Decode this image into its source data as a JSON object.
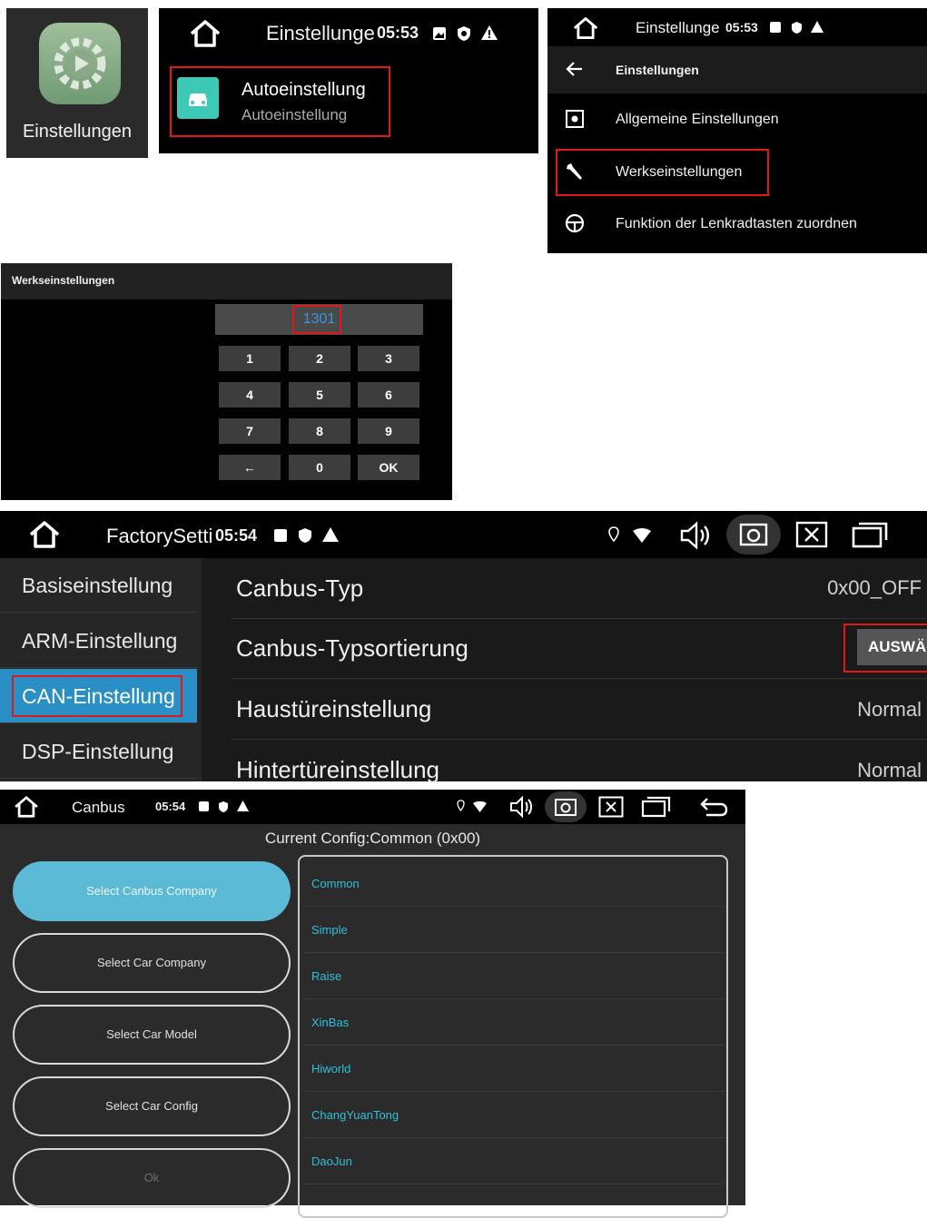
{
  "panel1": {
    "app_label": "Einstellungen"
  },
  "panel2": {
    "title": "Einstellunge",
    "time": "05:53",
    "item_title": "Autoeinstellung",
    "item_subtitle": "Autoeinstellung"
  },
  "panel3": {
    "title": "Einstellunge",
    "time": "05:53",
    "back_label": "Einstellungen",
    "items": [
      {
        "label": "Allgemeine Einstellungen",
        "icon": "settings-icon"
      },
      {
        "label": "Werkseinstellungen",
        "icon": "wrench-icon"
      },
      {
        "label": "Funktion der Lenkradtasten zuordnen",
        "icon": "steering-wheel-icon"
      }
    ]
  },
  "panel4": {
    "header": "Werkseinstellungen",
    "password_value": "1301",
    "keys": [
      "1",
      "2",
      "3",
      "4",
      "5",
      "6",
      "7",
      "8",
      "9",
      "←",
      "0",
      "OK"
    ]
  },
  "panel5": {
    "title": "FactorySetti",
    "time": "05:54",
    "sidebar": [
      "Basiseinstellung",
      "ARM-Einstellung",
      "CAN-Einstellung",
      "DSP-Einstellung"
    ],
    "active_sidebar": "CAN-Einstellung",
    "rows": [
      {
        "label": "Canbus-Typ",
        "value": "0x00_OFF"
      },
      {
        "label": "Canbus-Typsortierung",
        "value": "AUSWÄ"
      },
      {
        "label": "Haustüreinstellung",
        "value": "Normal"
      },
      {
        "label": "Hintertüreinstellung",
        "value": "Normal"
      }
    ]
  },
  "panel6": {
    "title": "Canbus",
    "time": "05:54",
    "current_config": "Current Config:Common (0x00)",
    "buttons": [
      "Select Canbus Company",
      "Select Car Company",
      "Select Car Model",
      "Select Car Config",
      "Ok"
    ],
    "list": [
      "Common",
      "Simple",
      "Raise",
      "XinBas",
      "Hiworld",
      "ChangYuanTong",
      "DaoJun"
    ]
  },
  "colors": {
    "highlight_red": "#e01818",
    "accent_blue": "#2a8fc4",
    "pill_active": "#5bbad6",
    "list_text": "#2ec0da"
  }
}
